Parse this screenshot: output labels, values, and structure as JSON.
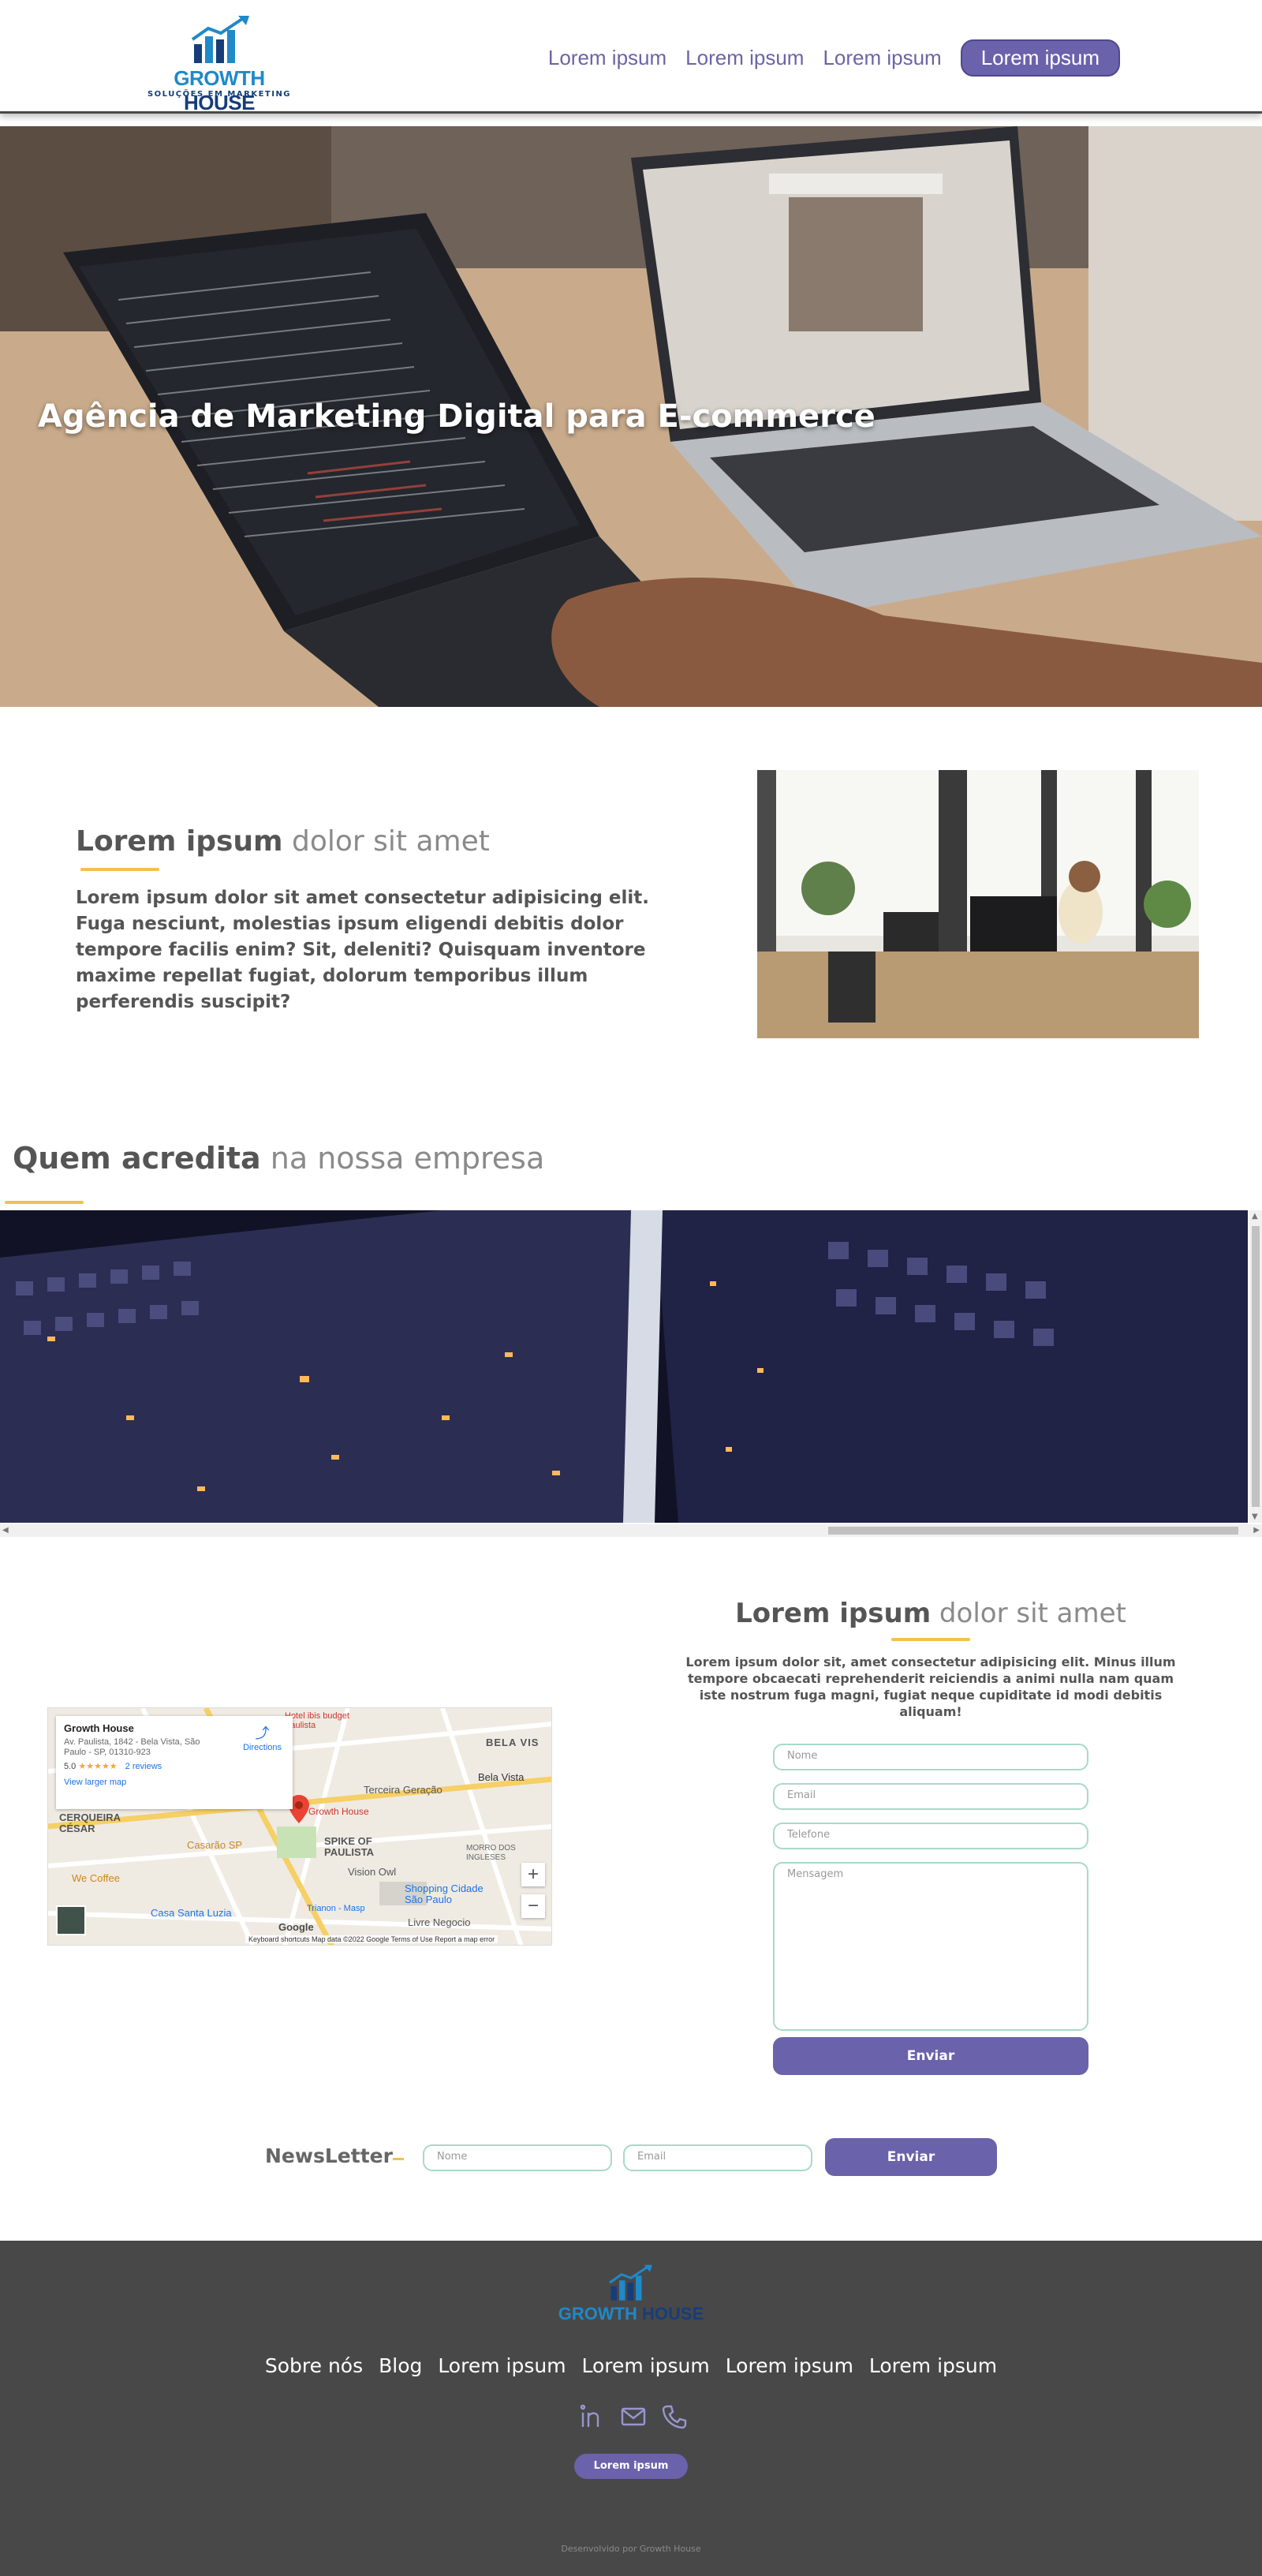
{
  "header": {
    "logo": {
      "name_part1": "GROWTH",
      "name_part2": " HOUSE",
      "tagline": "SOLUÇÕES EM MARKETING"
    },
    "nav": [
      "Lorem ipsum",
      "Lorem ipsum",
      "Lorem ipsum"
    ],
    "cta_label": "Lorem ipsum"
  },
  "hero": {
    "title": "Agência de Marketing Digital para E-commerce"
  },
  "about": {
    "title_bold": "Lorem ipsum",
    "title_light": " dolor sit amet",
    "text": "Lorem ipsum dolor sit amet consectetur adipisicing elit. Fuga nesciunt, molestias ipsum eligendi debitis dolor tempore facilis enim? Sit, deleniti? Quisquam inventore maxime repellat fugiat, dolorum temporibus illum perferendis suscipit?"
  },
  "partners": {
    "title_bold": "Quem acredita",
    "title_light": " na nossa empresa"
  },
  "map": {
    "place_name": "Growth House",
    "address": "Av. Paulista, 1842 - Bela Vista, São Paulo - SP, 01310-923",
    "rating": "5.0",
    "stars": "★★★★★",
    "reviews": "2 reviews",
    "larger_map": "View larger map",
    "directions": "Directions",
    "labels": [
      "BELA VIS",
      "Bela Vista",
      "Terceira Geração",
      "CERQUEIRA CÉSAR",
      "Casarão SP",
      "SPIKE OF PAULISTA",
      "MORRO DOS INGLESES",
      "We Coffee",
      "Vision Owl",
      "Shopping Cidade São Paulo",
      "Casa Santa Luzia",
      "Trianon - Masp",
      "Livre Negocio",
      "Growth House",
      "Hotel ibis budget Paulista"
    ],
    "zoom_in": "+",
    "zoom_out": "−",
    "footer": "Keyboard shortcuts   Map data ©2022 Google   Terms of Use   Report a map error",
    "google": "Google"
  },
  "contact": {
    "title_bold": "Lorem ipsum",
    "title_light": " dolor sit amet",
    "text": "Lorem ipsum dolor sit, amet consectetur adipisicing elit. Minus illum tempore obcaecati reprehenderit reiciendis a animi nulla nam quam iste nostrum fuga magni, fugiat neque cupiditate id modi debitis aliquam!",
    "name_placeholder": "Nome",
    "email_placeholder": "Email",
    "phone_placeholder": "Telefone",
    "message_placeholder": "Mensagem",
    "submit_label": "Enviar"
  },
  "newsletter": {
    "label": "NewsLetter",
    "name_placeholder": "Nome",
    "email_placeholder": "Email",
    "submit_label": "Enviar"
  },
  "footer": {
    "logo": {
      "name_part1": "GROWTH",
      "name_part2": " HOUSE"
    },
    "links": [
      "Sobre nós",
      "Blog",
      "Lorem ipsum",
      "Lorem ipsum",
      "Lorem ipsum",
      "Lorem ipsum"
    ],
    "icons": [
      "linkedin-icon",
      "mail-icon",
      "phone-icon"
    ],
    "button_label": "Lorem ipsum",
    "copyright": "Desenvolvido por Growth House"
  },
  "colors": {
    "accent": "#6a62aa",
    "underline": "#f2c14a",
    "footer_bg": "#484848",
    "field_border": "#a9d9c8"
  }
}
